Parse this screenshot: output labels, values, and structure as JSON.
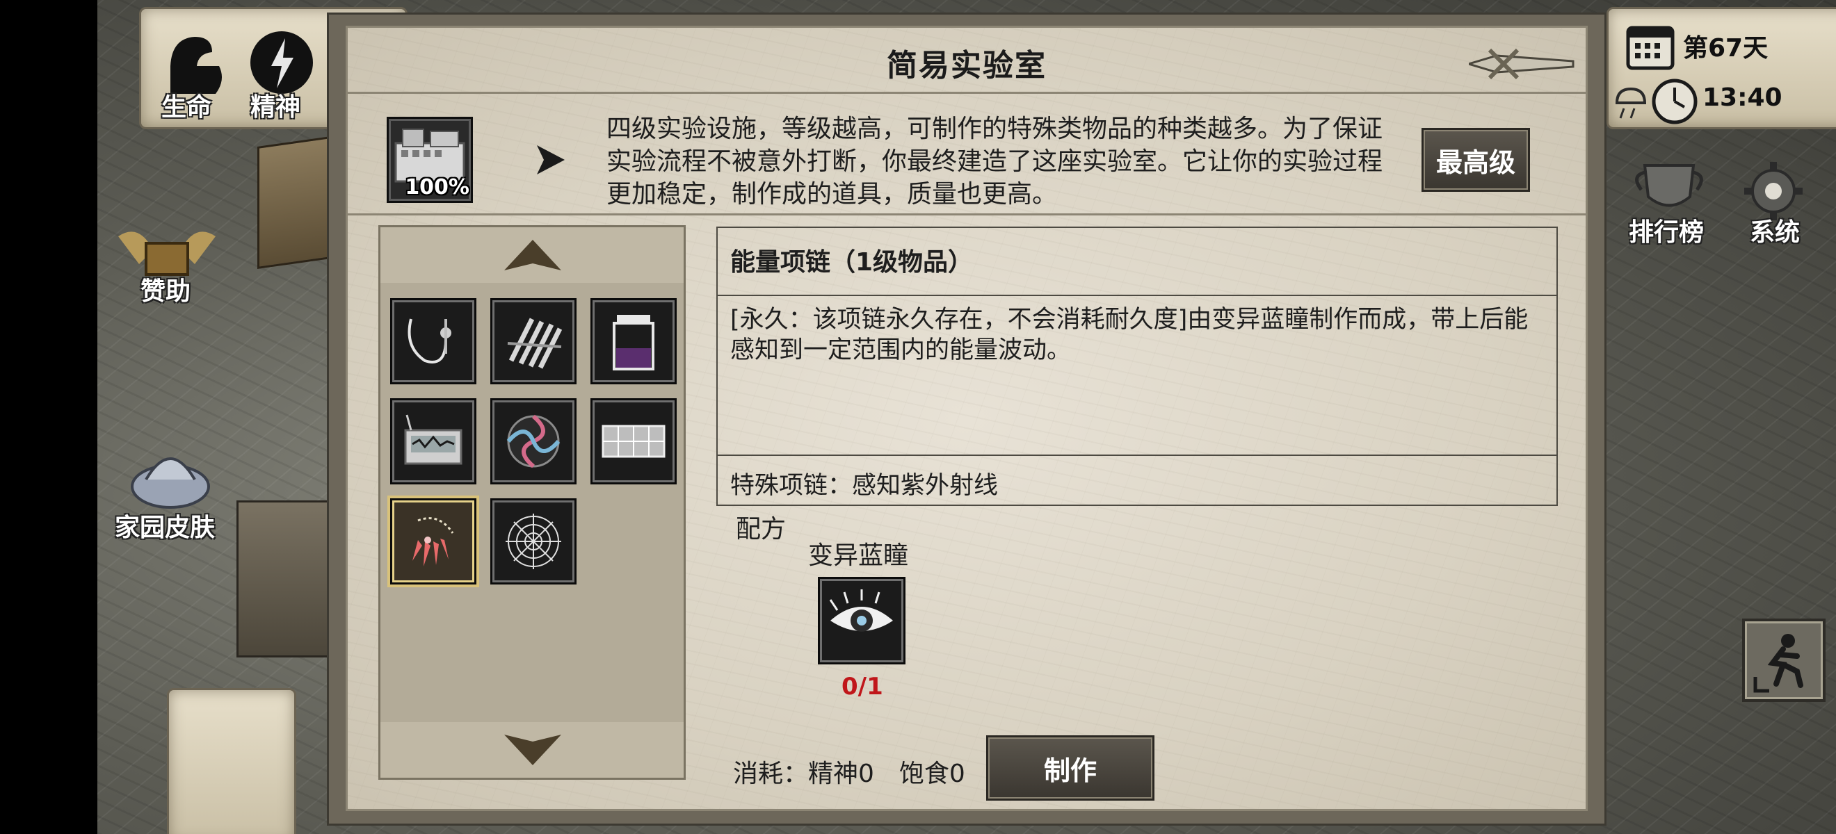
{
  "hud": {
    "life_label": "生命",
    "spirit_label": "精神",
    "sponsor_label": "赞助",
    "home_skin_label": "家园皮肤",
    "day_label": "第67天",
    "time_label": "13:40",
    "ranking_label": "排行榜",
    "system_label": "系统"
  },
  "dialog": {
    "title": "简易实验室",
    "facility": {
      "progress_label": "100%",
      "description": "四级实验设施，等级越高，可制作的特殊类物品的种类越多。为了保证实验流程不被意外打断，你最终建造了这座实验室。它让你的实验过程更加稳定，制作成的道具，质量也更高。",
      "level_button": "最高级"
    },
    "items": [
      {
        "icon": "necklace-icon"
      },
      {
        "icon": "raft-icon"
      },
      {
        "icon": "jar-icon"
      },
      {
        "icon": "radar-device-icon"
      },
      {
        "icon": "swirl-orb-icon"
      },
      {
        "icon": "grid-panel-icon"
      },
      {
        "icon": "crystal-necklace-icon",
        "selected": true
      },
      {
        "icon": "spider-web-icon"
      }
    ],
    "detail": {
      "name": "能量项链（1级物品）",
      "description": "[永久：该项链永久存在，不会消耗耐久度]由变异蓝瞳制作而成，带上后能感知到一定范围内的能量波动。",
      "effect": "特殊项链：感知紫外射线"
    },
    "recipe": {
      "label": "配方",
      "ingredient_name": "变异蓝瞳",
      "ingredient_icon": "eye-icon",
      "ingredient_count": "0/1"
    },
    "cost_label": "消耗：精神0　饱食0",
    "craft_button": "制作"
  },
  "colors": {
    "count_red": "#c0161a",
    "button_dark": "#3a3630",
    "parchment": "#ddd6c6"
  }
}
